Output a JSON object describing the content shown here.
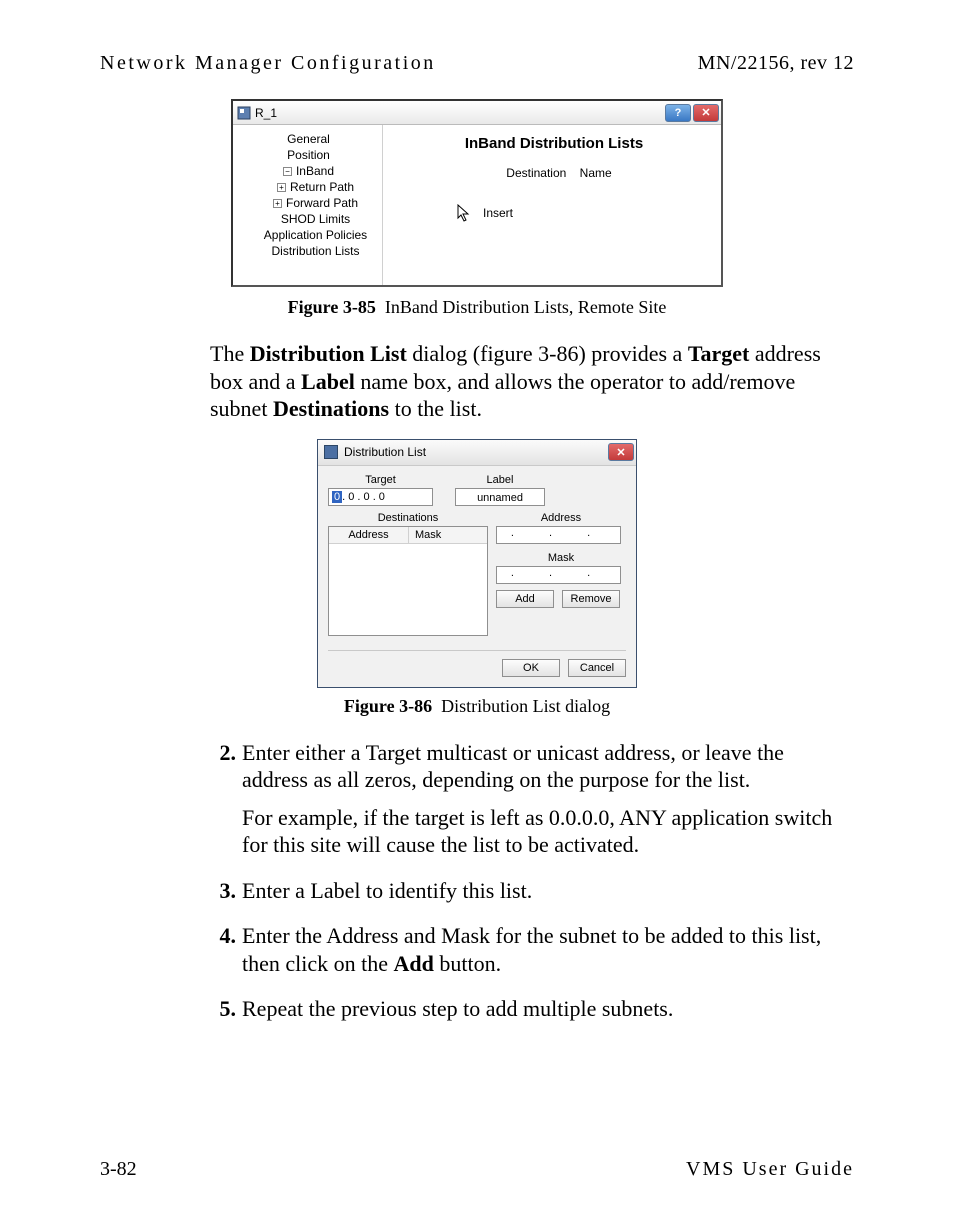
{
  "header": {
    "left": "Network Manager Configuration",
    "right": "MN/22156, rev 12"
  },
  "fig85": {
    "window_title": "R_1",
    "help_btn": "?",
    "close_btn": "✕",
    "tree": {
      "n_general": "General",
      "n_position": "Position",
      "n_inband": "InBand",
      "n_return": "Return Path",
      "n_forward": "Forward Path",
      "n_shod": "SHOD Limits",
      "n_app": "Application Policies",
      "n_dist": "Distribution Lists"
    },
    "panel_title": "InBand Distribution Lists",
    "col_dest": "Destination",
    "col_name": "Name",
    "insert_label": "Insert",
    "caption_bold": "Figure 3-85",
    "caption_rest": "InBand Distribution Lists, Remote Site"
  },
  "para1_parts": {
    "p1": "The ",
    "b1": "Distribution List",
    "p2": " dialog (figure 3-86) provides a ",
    "b2": "Target",
    "p3": " address box and a ",
    "b3": "Label",
    "p4": " name box, and allows the operator to add/remove subnet ",
    "b4": "Destinations",
    "p5": " to the list."
  },
  "fig86": {
    "window_title": "Distribution List",
    "close_btn": "✕",
    "lbl_target": "Target",
    "lbl_label": "Label",
    "target_ip_first": "0",
    "target_ip_rest": " .  0  .  0  .  0",
    "label_value": "unnamed",
    "lbl_destinations": "Destinations",
    "col_address": "Address",
    "col_mask": "Mask",
    "lbl_address": "Address",
    "lbl_mask": "Mask",
    "ip_dots": ".  .  .",
    "btn_add": "Add",
    "btn_remove": "Remove",
    "btn_ok": "OK",
    "btn_cancel": "Cancel",
    "caption_bold": "Figure 3-86",
    "caption_rest": "Distribution List dialog"
  },
  "steps": {
    "s2_num": "2.",
    "s2": "Enter either a Target multicast or unicast address, or leave the address as all zeros, depending on the purpose for the list.",
    "s2_cont": "For example, if the target is left as 0.0.0.0, ANY application switch for this site will cause the list to be activated.",
    "s3_num": "3.",
    "s3": "Enter a Label to identify this list.",
    "s4_num": "4.",
    "s4_a": "Enter the Address and Mask for the subnet to be added to this list, then click on the ",
    "s4_bold": "Add",
    "s4_b": " button.",
    "s5_num": "5.",
    "s5": "Repeat the previous step to add multiple subnets."
  },
  "footer": {
    "left": "3-82",
    "right": "VMS User Guide"
  }
}
